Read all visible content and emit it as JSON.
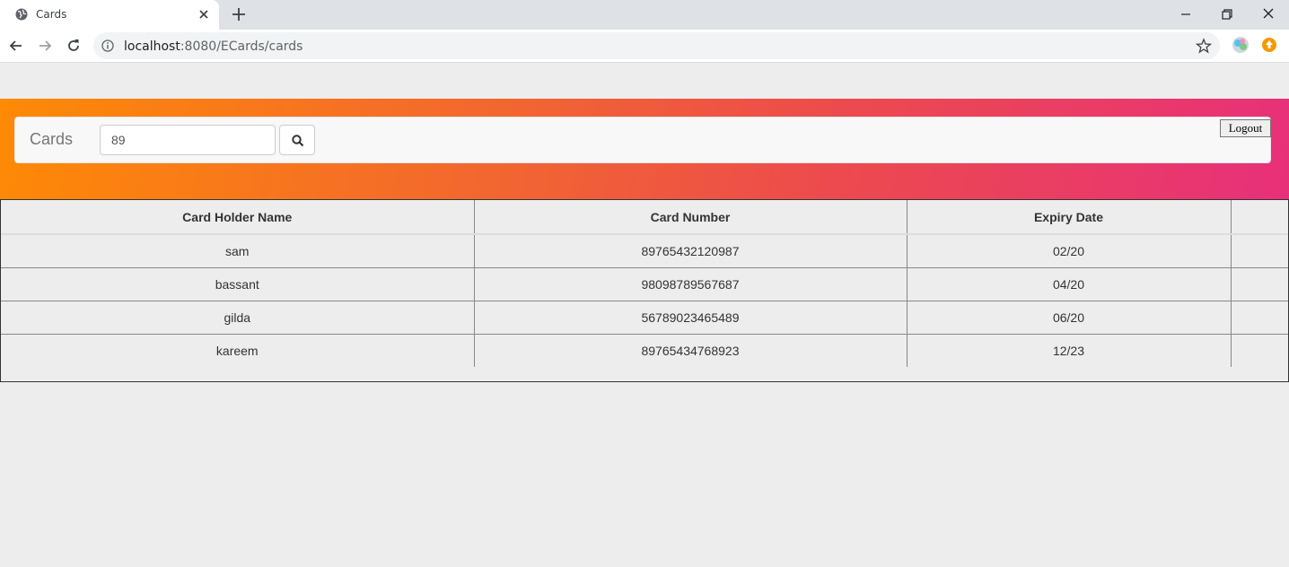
{
  "browser": {
    "tab_title": "Cards",
    "url_host": "localhost",
    "url_rest": ":8080/ECards/cards"
  },
  "navbar": {
    "brand": "Cards",
    "search_value": "89",
    "logout_label": "Logout"
  },
  "table": {
    "headers": [
      "Card Holder Name",
      "Card Number",
      "Expiry Date",
      ""
    ],
    "rows": [
      [
        "sam",
        "89765432120987",
        "02/20"
      ],
      [
        "bassant",
        "98098789567687",
        "04/20"
      ],
      [
        "gilda",
        "56789023465489",
        "06/20"
      ],
      [
        "kareem",
        "89765434768923",
        "12/23"
      ]
    ]
  }
}
